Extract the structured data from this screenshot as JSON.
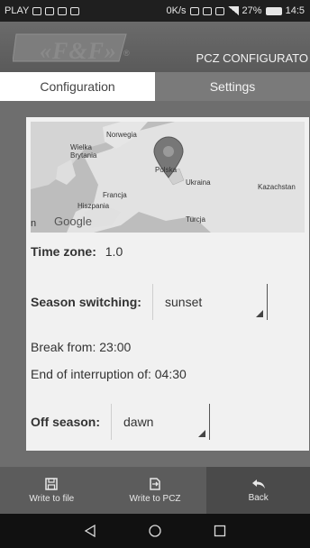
{
  "status_bar": {
    "carrier": "PLAY",
    "speed": "0K/s",
    "network": "LTE",
    "battery": "27%",
    "time": "14:5"
  },
  "header": {
    "logo_text": "«F&F»",
    "logo_reg": "®",
    "title": "PCZ CONFIGURATO"
  },
  "tabs": [
    {
      "label": "Configuration",
      "active": true
    },
    {
      "label": "Settings",
      "active": false
    }
  ],
  "map": {
    "labels": [
      "Norwegia",
      "Wielka Brytania",
      "Polska",
      "Ukraina",
      "Kazachstan",
      "Francja",
      "Hiszpania",
      "Turcja"
    ],
    "google": "Google",
    "edge_letter": "n"
  },
  "form": {
    "time_zone_label": "Time zone:",
    "time_zone_value": "1.0",
    "season_switching_label": "Season switching:",
    "season_switching_value": "sunset",
    "break_from": "Break from: 23:00",
    "end_interruption": "End of interruption of: 04:30",
    "off_season_label": "Off season:",
    "off_season_value": "dawn"
  },
  "bottom_bar": {
    "write_file": "Write to file",
    "write_pcz": "Write to PCZ",
    "back": "Back"
  },
  "colors": {
    "header_bg": "#5f5f5f",
    "tab_active": "#ffffff",
    "tab_inactive": "#7a7a7a",
    "card_bg": "#f1f1f1",
    "bottom_bar": "#5c5c5c"
  }
}
